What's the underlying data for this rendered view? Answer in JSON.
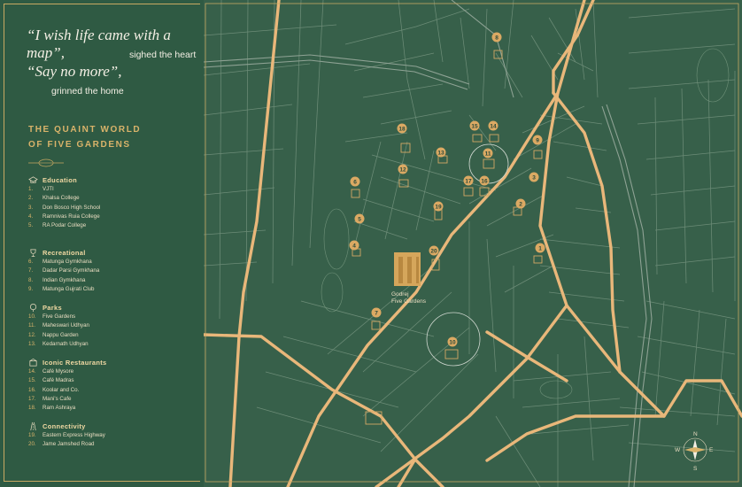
{
  "quote": {
    "line1": "“I wish life came with a map”,",
    "line1_sub": "sighed the heart",
    "line2": "“Say no more”,",
    "line2_sub": "grinned the home"
  },
  "title": {
    "line1": "THE QUAINT WORLD",
    "line2": "OF FIVE GARDENS"
  },
  "legend": {
    "education": {
      "heading": "Education",
      "items": [
        {
          "num": "1.",
          "name": "VJTI"
        },
        {
          "num": "2.",
          "name": "Khalsa College"
        },
        {
          "num": "3.",
          "name": "Don Bosco High School"
        },
        {
          "num": "4.",
          "name": "Ramnivas Ruia College"
        },
        {
          "num": "5.",
          "name": "RA Podar College"
        }
      ]
    },
    "recreational": {
      "heading": "Recreational",
      "items": [
        {
          "num": "6.",
          "name": "Matunga Gymkhana"
        },
        {
          "num": "7.",
          "name": "Dadar Parsi Gymkhana"
        },
        {
          "num": "8.",
          "name": "Indian Gymkhana"
        },
        {
          "num": "9.",
          "name": "Matunga Gujrati Club"
        }
      ]
    },
    "parks": {
      "heading": "Parks",
      "items": [
        {
          "num": "10.",
          "name": "Five Gardens"
        },
        {
          "num": "11.",
          "name": "Maheswari Udhyan"
        },
        {
          "num": "12.",
          "name": "Nappu Garden"
        },
        {
          "num": "13.",
          "name": "Kedarnath Udhyan"
        }
      ]
    },
    "restaurants": {
      "heading": "Iconic Restaurants",
      "items": [
        {
          "num": "14.",
          "name": "Café Mysore"
        },
        {
          "num": "15.",
          "name": "Café Madras"
        },
        {
          "num": "16.",
          "name": "Koolar and Co."
        },
        {
          "num": "17.",
          "name": "Mani's Cafe"
        },
        {
          "num": "18.",
          "name": "Ram Ashraya"
        }
      ]
    },
    "connectivity": {
      "heading": "Connectivity",
      "items": [
        {
          "num": "19.",
          "name": "Eastern Express Highway"
        },
        {
          "num": "20.",
          "name": "Jame Jamshed Road"
        }
      ]
    }
  },
  "map": {
    "project_label_line1": "Godrej",
    "project_label_line2": "Five Gardens",
    "markers": [
      {
        "num": "1",
        "category": "education"
      },
      {
        "num": "2",
        "category": "education"
      },
      {
        "num": "3",
        "category": "education"
      },
      {
        "num": "4",
        "category": "education"
      },
      {
        "num": "5",
        "category": "education"
      },
      {
        "num": "6",
        "category": "recreational"
      },
      {
        "num": "7",
        "category": "recreational"
      },
      {
        "num": "8",
        "category": "recreational"
      },
      {
        "num": "9",
        "category": "recreational"
      },
      {
        "num": "10",
        "category": "parks"
      },
      {
        "num": "11",
        "category": "parks"
      },
      {
        "num": "12",
        "category": "parks"
      },
      {
        "num": "13",
        "category": "parks"
      },
      {
        "num": "14",
        "category": "restaurants"
      },
      {
        "num": "15",
        "category": "restaurants"
      },
      {
        "num": "16",
        "category": "restaurants"
      },
      {
        "num": "17",
        "category": "restaurants"
      },
      {
        "num": "18",
        "category": "restaurants"
      },
      {
        "num": "19",
        "category": "connectivity"
      },
      {
        "num": "20",
        "category": "connectivity"
      }
    ],
    "compass": {
      "n": "N",
      "s": "S",
      "e": "E",
      "w": "W"
    }
  },
  "colors": {
    "sidebar_bg": "#2f5a43",
    "map_bg": "#37604a",
    "road": "#e9b77a",
    "accent": "#d9b36a"
  }
}
